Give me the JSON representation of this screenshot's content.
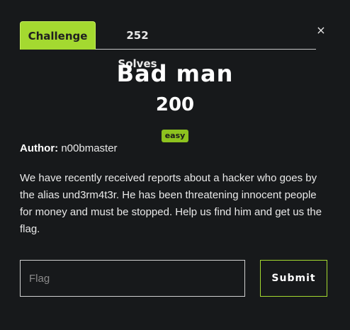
{
  "tabs": {
    "challenge_label": "Challenge",
    "solves_label": "252 Solves"
  },
  "close_glyph": "×",
  "challenge": {
    "name": "Bad man",
    "points": "200",
    "difficulty": "easy",
    "author_label": "Author:",
    "author": "n00bmaster",
    "description": "We have recently received reports about a hacker who goes by the alias und3rm4t3r. He has been threatening innocent people for money and must be stopped. Help us find him and get us the flag."
  },
  "form": {
    "flag_placeholder": "Flag",
    "flag_value": "",
    "submit_label": "Submit"
  },
  "colors": {
    "background": "#17191b",
    "accent": "#a4d930",
    "badge": "#8dc21f"
  },
  "icons": {
    "close": "close-icon"
  }
}
